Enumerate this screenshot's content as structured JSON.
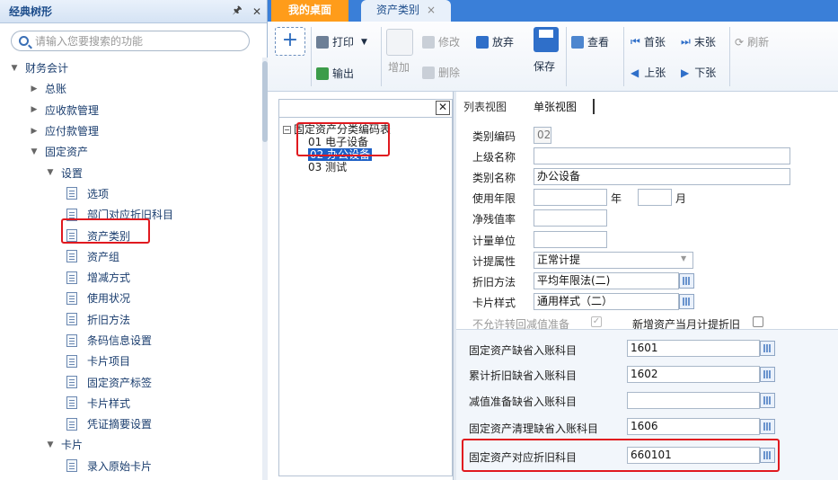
{
  "sidebar": {
    "title": "经典树形",
    "search_placeholder": "请输入您要搜索的功能",
    "tree": [
      {
        "label": "财务会计",
        "level": 0,
        "kind": "expanded"
      },
      {
        "label": "总账",
        "level": 1,
        "kind": "collapsed"
      },
      {
        "label": "应收款管理",
        "level": 1,
        "kind": "collapsed"
      },
      {
        "label": "应付款管理",
        "level": 1,
        "kind": "collapsed"
      },
      {
        "label": "固定资产",
        "level": 1,
        "kind": "expanded"
      },
      {
        "label": "设置",
        "level": 2,
        "kind": "expanded"
      },
      {
        "label": "选项",
        "level": 3,
        "kind": "leaf"
      },
      {
        "label": "部门对应折旧科目",
        "level": 3,
        "kind": "leaf"
      },
      {
        "label": "资产类别",
        "level": 3,
        "kind": "leaf"
      },
      {
        "label": "资产组",
        "level": 3,
        "kind": "leaf"
      },
      {
        "label": "增减方式",
        "level": 3,
        "kind": "leaf"
      },
      {
        "label": "使用状况",
        "level": 3,
        "kind": "leaf"
      },
      {
        "label": "折旧方法",
        "level": 3,
        "kind": "leaf"
      },
      {
        "label": "条码信息设置",
        "level": 3,
        "kind": "leaf"
      },
      {
        "label": "卡片项目",
        "level": 3,
        "kind": "leaf"
      },
      {
        "label": "固定资产标签",
        "level": 3,
        "kind": "leaf"
      },
      {
        "label": "卡片样式",
        "level": 3,
        "kind": "leaf"
      },
      {
        "label": "凭证摘要设置",
        "level": 3,
        "kind": "leaf"
      },
      {
        "label": "卡片",
        "level": 2,
        "kind": "expanded"
      },
      {
        "label": "录入原始卡片",
        "level": 3,
        "kind": "leaf"
      }
    ]
  },
  "tabs": {
    "desk": "我的桌面",
    "asset_class": "资产类别",
    "close_glyph": "×"
  },
  "toolbar": {
    "print": "打印",
    "export": "输出",
    "add": "增加",
    "edit": "修改",
    "delete": "删除",
    "discard": "放弃",
    "save": "保存",
    "view": "查看",
    "first": "首张",
    "last": "末张",
    "prev": "上张",
    "next": "下张",
    "refresh": "刷新"
  },
  "class_tree": {
    "root": "固定资产分类编码表",
    "nodes": [
      {
        "code": "01",
        "name": "电子设备"
      },
      {
        "code": "02",
        "name": "办公设备"
      },
      {
        "code": "03",
        "name": "测试"
      }
    ]
  },
  "view_tabs": {
    "list": "列表视图",
    "single": "单张视图"
  },
  "form": {
    "code_label": "类别编码",
    "code_value": "02",
    "parent_label": "上级名称",
    "parent_value": "",
    "name_label": "类别名称",
    "name_value": "办公设备",
    "life_label": "使用年限",
    "year_unit": "年",
    "month_unit": "月",
    "residual_label": "净残值率",
    "unit_label": "计量单位",
    "accrual_label": "计提属性",
    "accrual_value": "正常计提",
    "method_label": "折旧方法",
    "method_value": "平均年限法(二)",
    "style_label": "卡片样式",
    "style_value": "通用样式（二）",
    "no_reversal_label": "不允许转回减值准备",
    "new_month_label": "新增资产当月计提折旧",
    "acc_fa_label": "固定资产缺省入账科目",
    "acc_fa_value": "1601",
    "acc_dep_label": "累计折旧缺省入账科目",
    "acc_dep_value": "1602",
    "acc_imp_label": "减值准备缺省入账科目",
    "acc_imp_value": "",
    "acc_clean_label": "固定资产清理缺省入账科目",
    "acc_clean_value": "1606",
    "acc_corr_label": "固定资产对应折旧科目",
    "acc_corr_value": "660101"
  },
  "colors": {
    "accent": "#3a7fd8",
    "active_tab": "#ff9c1a",
    "highlight": "#e0191f",
    "selection": "#1c5fc6"
  }
}
